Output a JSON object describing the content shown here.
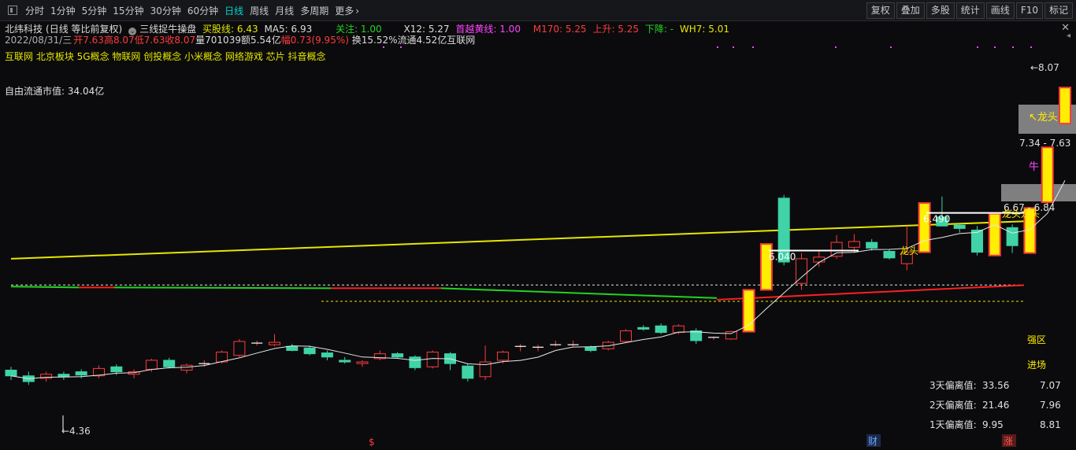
{
  "toolbar": {
    "tabs": [
      "分时",
      "1分钟",
      "5分钟",
      "15分钟",
      "30分钟",
      "60分钟",
      "日线",
      "周线",
      "月线",
      "多周期",
      "更多"
    ],
    "active_tab": "日线",
    "right_buttons": [
      "复权",
      "叠加",
      "多股",
      "统计",
      "画线",
      "F10",
      "标记"
    ]
  },
  "info": {
    "stock_name": "北纬科技",
    "adjust_mode": "(日线 等比前复权)",
    "indicator_name": "三线捉牛操盘",
    "buy_line": "买股线: 6.43",
    "ma5": "MA5: 6.93",
    "attention": "关注: 1.00",
    "x12": "X12: 5.27",
    "yellow_line": "首越黄线: 1.00",
    "m170": "M170: 5.25",
    "rise": "上升: 5.25",
    "fall": "下降: -",
    "wh7": "WH7: 5.01",
    "date": "2022/08/31/三",
    "open": "开7.63",
    "high": "高8.07",
    "low": "低7.63",
    "close": "收8.07",
    "volume": "量701039",
    "amount": "额5.54亿",
    "change": "幅0.73(9.95%)",
    "turnover": "换15.52%",
    "float": "流通4.52亿",
    "industry": "互联网",
    "concepts": "互联网 北京板块 5G概念 物联网 创投概念 小米概念 网络游戏 芯片 抖音概念",
    "free_float_cap": "自由流通市值: 34.04亿"
  },
  "colors": {
    "up": "#ff3b3b",
    "down": "#3fd3a7",
    "limit_up": "#ffee00",
    "yellow_line": "#e6e600",
    "green_line": "#22d322",
    "red_line": "#ff2020",
    "ma": "#e8e8e8"
  },
  "chart_data": {
    "type": "candlestick",
    "ylim": [
      4.0,
      8.4
    ],
    "candles": [
      {
        "o": 4.62,
        "h": 4.66,
        "l": 4.5,
        "c": 4.55
      },
      {
        "o": 4.55,
        "h": 4.6,
        "l": 4.44,
        "c": 4.48
      },
      {
        "o": 4.52,
        "h": 4.6,
        "l": 4.48,
        "c": 4.57
      },
      {
        "o": 4.57,
        "h": 4.6,
        "l": 4.5,
        "c": 4.54
      },
      {
        "o": 4.6,
        "h": 4.63,
        "l": 4.52,
        "c": 4.56
      },
      {
        "o": 4.55,
        "h": 4.68,
        "l": 4.52,
        "c": 4.64
      },
      {
        "o": 4.66,
        "h": 4.69,
        "l": 4.56,
        "c": 4.6
      },
      {
        "o": 4.57,
        "h": 4.63,
        "l": 4.52,
        "c": 4.6
      },
      {
        "o": 4.63,
        "h": 4.76,
        "l": 4.6,
        "c": 4.74
      },
      {
        "o": 4.74,
        "h": 4.77,
        "l": 4.64,
        "c": 4.66
      },
      {
        "o": 4.62,
        "h": 4.7,
        "l": 4.58,
        "c": 4.68
      },
      {
        "o": 4.7,
        "h": 4.74,
        "l": 4.66,
        "c": 4.7
      },
      {
        "o": 4.72,
        "h": 4.86,
        "l": 4.7,
        "c": 4.84
      },
      {
        "o": 4.8,
        "h": 5.0,
        "l": 4.78,
        "c": 4.97
      },
      {
        "o": 4.94,
        "h": 4.98,
        "l": 4.92,
        "c": 4.95
      },
      {
        "o": 4.93,
        "h": 5.06,
        "l": 4.91,
        "c": 4.96
      },
      {
        "o": 4.91,
        "h": 4.94,
        "l": 4.85,
        "c": 4.86
      },
      {
        "o": 4.89,
        "h": 4.92,
        "l": 4.8,
        "c": 4.82
      },
      {
        "o": 4.83,
        "h": 4.86,
        "l": 4.74,
        "c": 4.78
      },
      {
        "o": 4.74,
        "h": 4.78,
        "l": 4.7,
        "c": 4.72
      },
      {
        "o": 4.7,
        "h": 4.74,
        "l": 4.66,
        "c": 4.72
      },
      {
        "o": 4.76,
        "h": 4.86,
        "l": 4.74,
        "c": 4.82
      },
      {
        "o": 4.82,
        "h": 4.84,
        "l": 4.76,
        "c": 4.78
      },
      {
        "o": 4.78,
        "h": 4.8,
        "l": 4.62,
        "c": 4.65
      },
      {
        "o": 4.66,
        "h": 4.86,
        "l": 4.64,
        "c": 4.84
      },
      {
        "o": 4.82,
        "h": 4.84,
        "l": 4.62,
        "c": 4.7
      },
      {
        "o": 4.67,
        "h": 4.7,
        "l": 4.48,
        "c": 4.52
      },
      {
        "o": 4.54,
        "h": 4.92,
        "l": 4.5,
        "c": 4.72
      },
      {
        "o": 4.74,
        "h": 4.86,
        "l": 4.7,
        "c": 4.84
      },
      {
        "o": 4.91,
        "h": 4.94,
        "l": 4.85,
        "c": 4.91
      },
      {
        "o": 4.9,
        "h": 4.93,
        "l": 4.85,
        "c": 4.9
      },
      {
        "o": 4.92,
        "h": 4.98,
        "l": 4.91,
        "c": 4.93
      },
      {
        "o": 4.92,
        "h": 4.98,
        "l": 4.91,
        "c": 4.93
      },
      {
        "o": 4.9,
        "h": 4.92,
        "l": 4.84,
        "c": 4.86
      },
      {
        "o": 4.88,
        "h": 4.98,
        "l": 4.86,
        "c": 4.96
      },
      {
        "o": 4.97,
        "h": 5.12,
        "l": 4.96,
        "c": 5.1
      },
      {
        "o": 5.14,
        "h": 5.17,
        "l": 5.1,
        "c": 5.12
      },
      {
        "o": 5.16,
        "h": 5.19,
        "l": 5.06,
        "c": 5.08
      },
      {
        "o": 5.08,
        "h": 5.18,
        "l": 5.06,
        "c": 5.16
      },
      {
        "o": 5.1,
        "h": 5.13,
        "l": 4.94,
        "c": 4.98
      },
      {
        "o": 5.01,
        "h": 5.03,
        "l": 4.99,
        "c": 5.02
      },
      {
        "o": 5.0,
        "h": 5.1,
        "l": 4.99,
        "c": 5.09
      },
      {
        "o": 5.09,
        "h": 5.6,
        "l": 5.09,
        "c": 5.6
      },
      {
        "o": 5.6,
        "h": 6.16,
        "l": 5.6,
        "c": 6.16
      },
      {
        "o": 6.72,
        "h": 6.76,
        "l": 5.9,
        "c": 5.94
      },
      {
        "o": 5.68,
        "h": 6.05,
        "l": 5.6,
        "c": 5.98
      },
      {
        "o": 5.94,
        "h": 6.07,
        "l": 5.88,
        "c": 6.0
      },
      {
        "o": 6.01,
        "h": 6.27,
        "l": 5.98,
        "c": 6.18
      },
      {
        "o": 6.12,
        "h": 6.28,
        "l": 6.06,
        "c": 6.19
      },
      {
        "o": 6.18,
        "h": 6.22,
        "l": 6.08,
        "c": 6.11
      },
      {
        "o": 6.07,
        "h": 6.09,
        "l": 5.97,
        "c": 5.99
      },
      {
        "o": 5.92,
        "h": 6.38,
        "l": 5.84,
        "c": 6.06
      },
      {
        "o": 6.06,
        "h": 6.66,
        "l": 6.06,
        "c": 6.66
      },
      {
        "o": 6.49,
        "h": 6.74,
        "l": 6.38,
        "c": 6.38
      },
      {
        "o": 6.39,
        "h": 6.42,
        "l": 6.3,
        "c": 6.35
      },
      {
        "o": 6.33,
        "h": 6.38,
        "l": 6.02,
        "c": 6.06
      },
      {
        "o": 6.02,
        "h": 6.53,
        "l": 6.02,
        "c": 6.53
      },
      {
        "o": 6.36,
        "h": 6.4,
        "l": 6.05,
        "c": 6.14
      },
      {
        "o": 6.05,
        "h": 6.6,
        "l": 6.05,
        "c": 6.6
      },
      {
        "o": 6.67,
        "h": 7.34,
        "l": 6.63,
        "c": 7.34
      },
      {
        "o": 7.63,
        "h": 8.07,
        "l": 7.63,
        "c": 8.07
      }
    ],
    "limit_up_indices": [
      42,
      43,
      52,
      56,
      58,
      59,
      60
    ],
    "yellow_line": [
      5.98,
      6.44
    ],
    "green_line_end": 5.5,
    "red_line": [
      5.48,
      5.6
    ],
    "strong_zone": 5.66,
    "entry_level": 5.46,
    "labels": {
      "low_point": "4.36",
      "level_6040": "6.040",
      "level_6490": "6.490",
      "range_1": "7.34 - 7.63",
      "range_2": "6.67 - 6.84",
      "top_price": "8.07",
      "dragon_head": "龙头",
      "dragon_head_arrow": "↖龙头",
      "bull": "牛",
      "dragon_double": "龙头龙头",
      "strong_zone": "强区",
      "entry": "进场",
      "mark_s": "$",
      "mark_cai": "财",
      "mark_zhang": "涨"
    },
    "deviation": [
      {
        "label": "3天偏离值:",
        "value": "33.56",
        "price": "7.07"
      },
      {
        "label": "2天偏离值:",
        "value": "21.46",
        "price": "7.96"
      },
      {
        "label": "1天偏离值:",
        "value": "9.95",
        "price": "8.81"
      }
    ]
  }
}
